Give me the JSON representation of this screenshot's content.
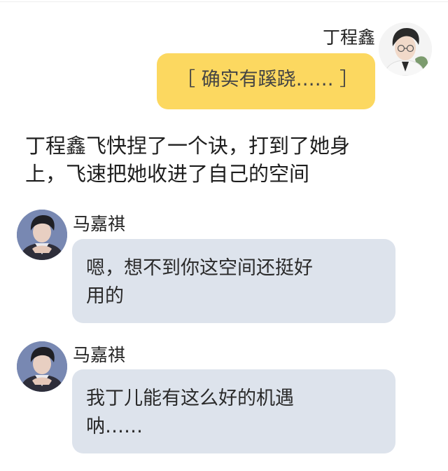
{
  "right_message": {
    "sender": "丁程鑫",
    "avatar_icon": "male-portrait-avatar-icon",
    "text": "［ 确实有蹊跷…… ］",
    "bubble_color": "#fcd860"
  },
  "narration": {
    "line1": "丁程鑫飞快捏了一个诀，打到了她身",
    "line2": "上，飞速把她收进了自己的空间"
  },
  "left_messages": [
    {
      "sender": "马嘉祺",
      "avatar_icon": "male-portrait-avatar-icon",
      "line1": "嗯，想不到你这空间还挺好",
      "line2": "用的",
      "bubble_color": "#dde3ec"
    },
    {
      "sender": "马嘉祺",
      "avatar_icon": "male-portrait-avatar-icon",
      "line1": "我丁儿能有这么好的机遇",
      "line2": "呐……",
      "bubble_color": "#dde3ec"
    }
  ]
}
